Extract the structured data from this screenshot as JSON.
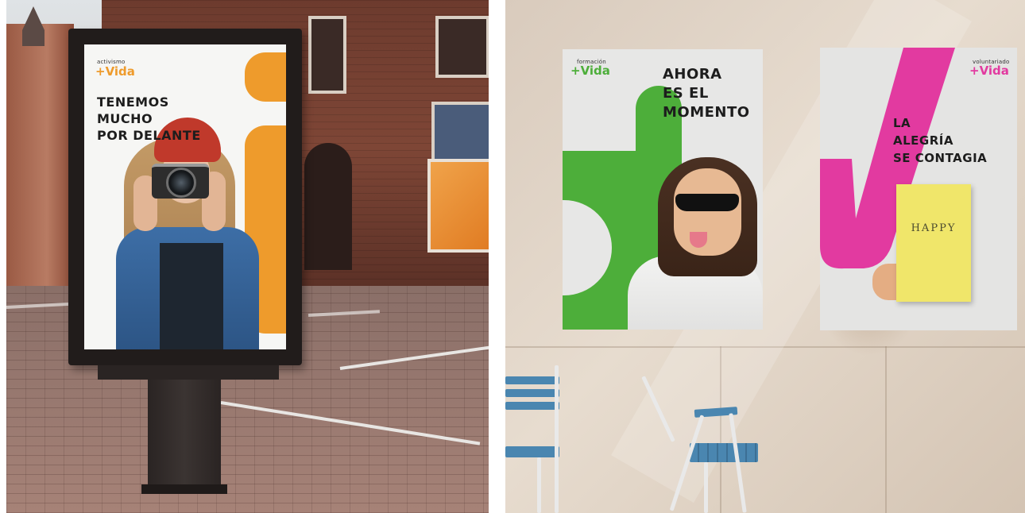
{
  "left_poster": {
    "brand_small": "activismo",
    "brand_big": "+Vida",
    "headline": [
      "TENEMOS",
      "MUCHO",
      "POR DELANTE"
    ],
    "accent": "#ee9b2c"
  },
  "middle_poster": {
    "brand_small": "formación",
    "brand_big": "+Vida",
    "headline": [
      "AHORA",
      "ES EL",
      "MOMENTO"
    ],
    "accent": "#4dae3a"
  },
  "right_poster": {
    "brand_small": "voluntariado",
    "brand_big": "+Vida",
    "headline": [
      "LA",
      "ALEGRÍA",
      "SE CONTAGIA"
    ],
    "card_text": "HAPPY",
    "accent": "#e23aa0"
  }
}
